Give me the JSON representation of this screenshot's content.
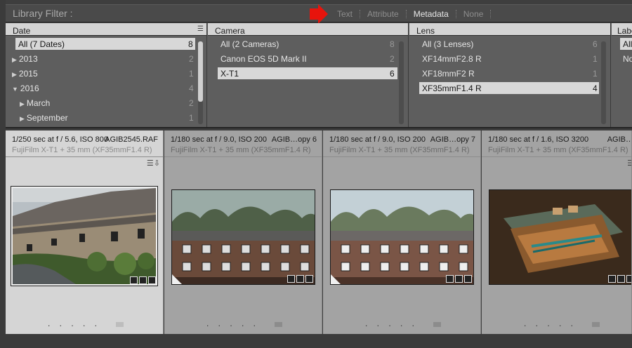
{
  "filter_bar": {
    "title": "Library Filter :",
    "tabs": [
      {
        "label": "Text",
        "active": false
      },
      {
        "label": "Attribute",
        "active": false
      },
      {
        "label": "Metadata",
        "active": true
      },
      {
        "label": "None",
        "active": false
      }
    ],
    "marker_color": "#e8140c"
  },
  "columns": [
    {
      "header": "Date",
      "rows": [
        {
          "label": "All (7 Dates)",
          "count": "8",
          "selected": true,
          "indent": 0,
          "expander": ""
        },
        {
          "label": "2013",
          "count": "2",
          "selected": false,
          "indent": 0,
          "expander": "▶"
        },
        {
          "label": "2015",
          "count": "1",
          "selected": false,
          "indent": 0,
          "expander": "▶"
        },
        {
          "label": "2016",
          "count": "4",
          "selected": false,
          "indent": 0,
          "expander": "▼"
        },
        {
          "label": "March",
          "count": "2",
          "selected": false,
          "indent": 1,
          "expander": "▶"
        },
        {
          "label": "September",
          "count": "1",
          "selected": false,
          "indent": 1,
          "expander": "▶"
        }
      ]
    },
    {
      "header": "Camera",
      "rows": [
        {
          "label": "All (2 Cameras)",
          "count": "8",
          "selected": false
        },
        {
          "label": "Canon EOS 5D Mark II",
          "count": "2",
          "selected": false
        },
        {
          "label": "X-T1",
          "count": "6",
          "selected": true
        }
      ]
    },
    {
      "header": "Lens",
      "rows": [
        {
          "label": "All (3 Lenses)",
          "count": "6",
          "selected": false
        },
        {
          "label": "XF14mmF2.8 R",
          "count": "1",
          "selected": false
        },
        {
          "label": "XF18mmF2 R",
          "count": "1",
          "selected": false
        },
        {
          "label": "XF35mmF1.4 R",
          "count": "4",
          "selected": true
        }
      ]
    },
    {
      "header": "Labe",
      "rows": [
        {
          "label": "All",
          "count": "",
          "selected": true
        },
        {
          "label": "No",
          "count": "",
          "selected": false
        }
      ]
    }
  ],
  "cells": [
    {
      "exif": "1/250 sec at f / 5.6, ISO 800",
      "filename": "AGIB2545.RAF",
      "camlens": "FujiFilm X-T1 + 35 mm (XF35mmF1.4 R)",
      "selected": true,
      "image": "cottages"
    },
    {
      "exif": "1/180 sec at f / 9.0, ISO 200",
      "filename": "AGIB…opy 6",
      "camlens": "FujiFilm X-T1 + 35 mm (XF35mmF1.4 R)",
      "selected": false,
      "image": "building-dark"
    },
    {
      "exif": "1/180 sec at f / 9.0, ISO 200",
      "filename": "AGIB…opy 7",
      "camlens": "FujiFilm X-T1 + 35 mm (XF35mmF1.4 R)",
      "selected": false,
      "image": "building-light"
    },
    {
      "exif": "1/180 sec at f / 1.6, ISO 3200",
      "filename": "AGIB…",
      "camlens": "FujiFilm X-T1 + 35 mm (XF35mmF1.4 R)",
      "selected": false,
      "image": "box"
    }
  ],
  "rating_dots": ". . . . .",
  "cell_icons": "☰⇩"
}
